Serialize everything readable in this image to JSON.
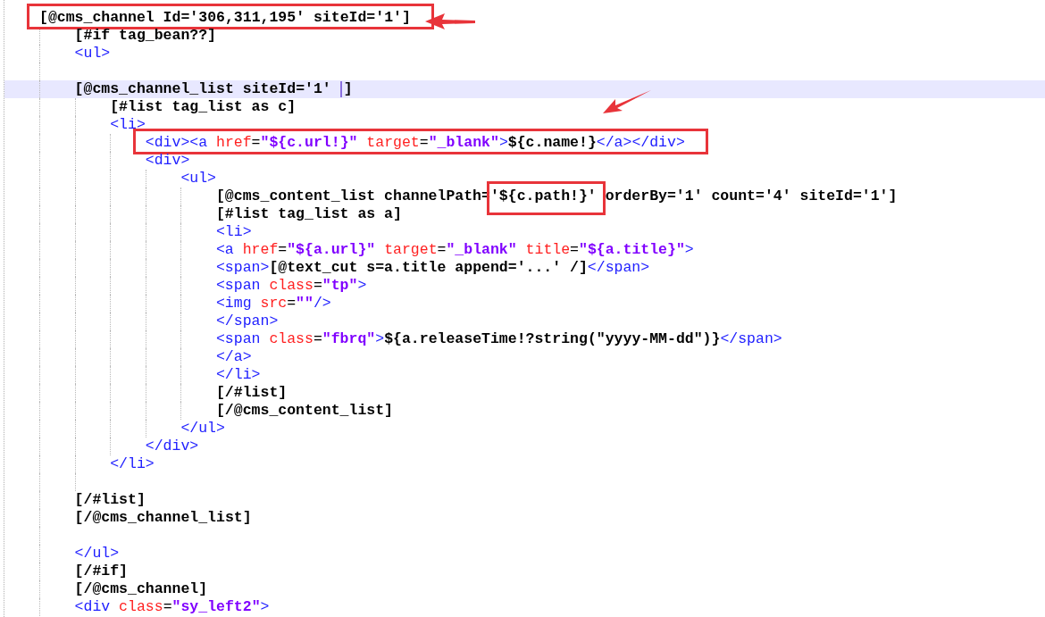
{
  "editor": {
    "lines": [
      {
        "kind": "code",
        "boxed": true,
        "arrow": {
          "kind": "left"
        },
        "tokens": [
          {
            "kind": "text",
            "text": "[@cms_channel Id='306,311,195' siteId='1']"
          }
        ],
        "children": [
          {
            "kind": "code",
            "tokens": [
              {
                "kind": "text",
                "text": "[#if tag_bean??]"
              }
            ]
          },
          {
            "kind": "code",
            "tokens": [
              {
                "kind": "tag",
                "text": "<ul>"
              }
            ]
          },
          {
            "kind": "blank"
          },
          {
            "kind": "code",
            "current": true,
            "tokens": [
              {
                "kind": "text",
                "text": "[@cms_channel_list siteId='1' "
              },
              {
                "kind": "text",
                "text": "]",
                "caret_before": true
              }
            ],
            "children": [
              {
                "kind": "code",
                "tokens": [
                  {
                    "kind": "text",
                    "text": "[#list tag_list as c]"
                  }
                ]
              },
              {
                "kind": "code",
                "tokens": [
                  {
                    "kind": "tag",
                    "text": "<li>"
                  }
                ],
                "children": [
                  {
                    "kind": "code",
                    "boxed": true,
                    "arrow": {
                      "kind": "down-left"
                    },
                    "tokens": [
                      {
                        "kind": "tag",
                        "text": "<div><a "
                      },
                      {
                        "kind": "attr",
                        "text": "href"
                      },
                      {
                        "kind": "punct",
                        "text": "="
                      },
                      {
                        "kind": "value",
                        "text": "\"${c.url!}\""
                      },
                      {
                        "kind": "attr",
                        "text": " target"
                      },
                      {
                        "kind": "punct",
                        "text": "="
                      },
                      {
                        "kind": "value",
                        "text": "\"_blank\""
                      },
                      {
                        "kind": "tag",
                        "text": ">"
                      },
                      {
                        "kind": "text",
                        "text": "${c.name!}"
                      },
                      {
                        "kind": "tag",
                        "text": "</a></div>"
                      }
                    ]
                  },
                  {
                    "kind": "code",
                    "tokens": [
                      {
                        "kind": "tag",
                        "text": "<div>"
                      }
                    ],
                    "children": [
                      {
                        "kind": "code",
                        "tokens": [
                          {
                            "kind": "tag",
                            "text": "<ul>"
                          }
                        ],
                        "children": [
                          {
                            "kind": "code",
                            "tokens": [
                              {
                                "kind": "text",
                                "text": "[@cms_content_list channelPath="
                              },
                              {
                                "kind": "text",
                                "text": "'${c.path!}'",
                                "boxed": true
                              },
                              {
                                "kind": "text",
                                "text": " orderBy='1' count='4' siteId='1']"
                              }
                            ]
                          },
                          {
                            "kind": "code",
                            "tokens": [
                              {
                                "kind": "text",
                                "text": "[#list tag_list as a]"
                              }
                            ]
                          },
                          {
                            "kind": "code",
                            "tokens": [
                              {
                                "kind": "tag",
                                "text": "<li>"
                              }
                            ]
                          },
                          {
                            "kind": "code",
                            "tokens": [
                              {
                                "kind": "tag",
                                "text": "<a "
                              },
                              {
                                "kind": "attr",
                                "text": "href"
                              },
                              {
                                "kind": "punct",
                                "text": "="
                              },
                              {
                                "kind": "value",
                                "text": "\"${a.url}\""
                              },
                              {
                                "kind": "attr",
                                "text": " target"
                              },
                              {
                                "kind": "punct",
                                "text": "="
                              },
                              {
                                "kind": "value",
                                "text": "\"_blank\""
                              },
                              {
                                "kind": "attr",
                                "text": " title"
                              },
                              {
                                "kind": "punct",
                                "text": "="
                              },
                              {
                                "kind": "value",
                                "text": "\"${a.title}\""
                              },
                              {
                                "kind": "tag",
                                "text": ">"
                              }
                            ]
                          },
                          {
                            "kind": "code",
                            "tokens": [
                              {
                                "kind": "tag",
                                "text": "<span>"
                              },
                              {
                                "kind": "text",
                                "text": "[@text_cut s=a.title append='...' /]"
                              },
                              {
                                "kind": "tag",
                                "text": "</span>"
                              }
                            ]
                          },
                          {
                            "kind": "code",
                            "tokens": [
                              {
                                "kind": "tag",
                                "text": "<span "
                              },
                              {
                                "kind": "attr",
                                "text": "class"
                              },
                              {
                                "kind": "punct",
                                "text": "="
                              },
                              {
                                "kind": "value",
                                "text": "\"tp\""
                              },
                              {
                                "kind": "tag",
                                "text": ">"
                              }
                            ]
                          },
                          {
                            "kind": "code",
                            "tokens": [
                              {
                                "kind": "tag",
                                "text": "<img "
                              },
                              {
                                "kind": "attr",
                                "text": "src"
                              },
                              {
                                "kind": "punct",
                                "text": "="
                              },
                              {
                                "kind": "value",
                                "text": "\"\""
                              },
                              {
                                "kind": "tag",
                                "text": "/>"
                              }
                            ]
                          },
                          {
                            "kind": "code",
                            "tokens": [
                              {
                                "kind": "tag",
                                "text": "</span>"
                              }
                            ]
                          },
                          {
                            "kind": "code",
                            "tokens": [
                              {
                                "kind": "tag",
                                "text": "<span "
                              },
                              {
                                "kind": "attr",
                                "text": "class"
                              },
                              {
                                "kind": "punct",
                                "text": "="
                              },
                              {
                                "kind": "value",
                                "text": "\"fbrq\""
                              },
                              {
                                "kind": "tag",
                                "text": ">"
                              },
                              {
                                "kind": "text",
                                "text": "${a.releaseTime!?string(\"yyyy-MM-dd\")}"
                              },
                              {
                                "kind": "tag",
                                "text": "</span>"
                              }
                            ]
                          },
                          {
                            "kind": "code",
                            "tokens": [
                              {
                                "kind": "tag",
                                "text": "</a>"
                              }
                            ]
                          },
                          {
                            "kind": "code",
                            "tokens": [
                              {
                                "kind": "tag",
                                "text": "</li>"
                              }
                            ]
                          },
                          {
                            "kind": "code",
                            "tokens": [
                              {
                                "kind": "text",
                                "text": "[/#list]"
                              }
                            ]
                          },
                          {
                            "kind": "code",
                            "tokens": [
                              {
                                "kind": "text",
                                "text": "[/@cms_content_list]"
                              }
                            ]
                          }
                        ]
                      },
                      {
                        "kind": "code",
                        "tokens": [
                          {
                            "kind": "tag",
                            "text": "</ul>"
                          }
                        ]
                      }
                    ]
                  },
                  {
                    "kind": "code",
                    "tokens": [
                      {
                        "kind": "tag",
                        "text": "</div>"
                      }
                    ]
                  }
                ]
              },
              {
                "kind": "code",
                "tokens": [
                  {
                    "kind": "tag",
                    "text": "</li>"
                  }
                ]
              },
              {
                "kind": "blank"
              }
            ]
          },
          {
            "kind": "code",
            "tokens": [
              {
                "kind": "text",
                "text": "[/#list]"
              }
            ]
          },
          {
            "kind": "code",
            "tokens": [
              {
                "kind": "text",
                "text": "[/@cms_channel_list]"
              }
            ]
          },
          {
            "kind": "blank"
          },
          {
            "kind": "code",
            "tokens": [
              {
                "kind": "tag",
                "text": "</ul>"
              }
            ]
          },
          {
            "kind": "code",
            "tokens": [
              {
                "kind": "text",
                "text": "[/#if]"
              }
            ]
          },
          {
            "kind": "code",
            "tokens": [
              {
                "kind": "text",
                "text": "[/@cms_channel]"
              }
            ]
          },
          {
            "kind": "code",
            "tokens": [
              {
                "kind": "tag",
                "text": "<div "
              },
              {
                "kind": "attr",
                "text": "class"
              },
              {
                "kind": "punct",
                "text": "="
              },
              {
                "kind": "value",
                "text": "\"sy_left2\""
              },
              {
                "kind": "tag",
                "text": ">"
              }
            ]
          }
        ]
      }
    ]
  }
}
